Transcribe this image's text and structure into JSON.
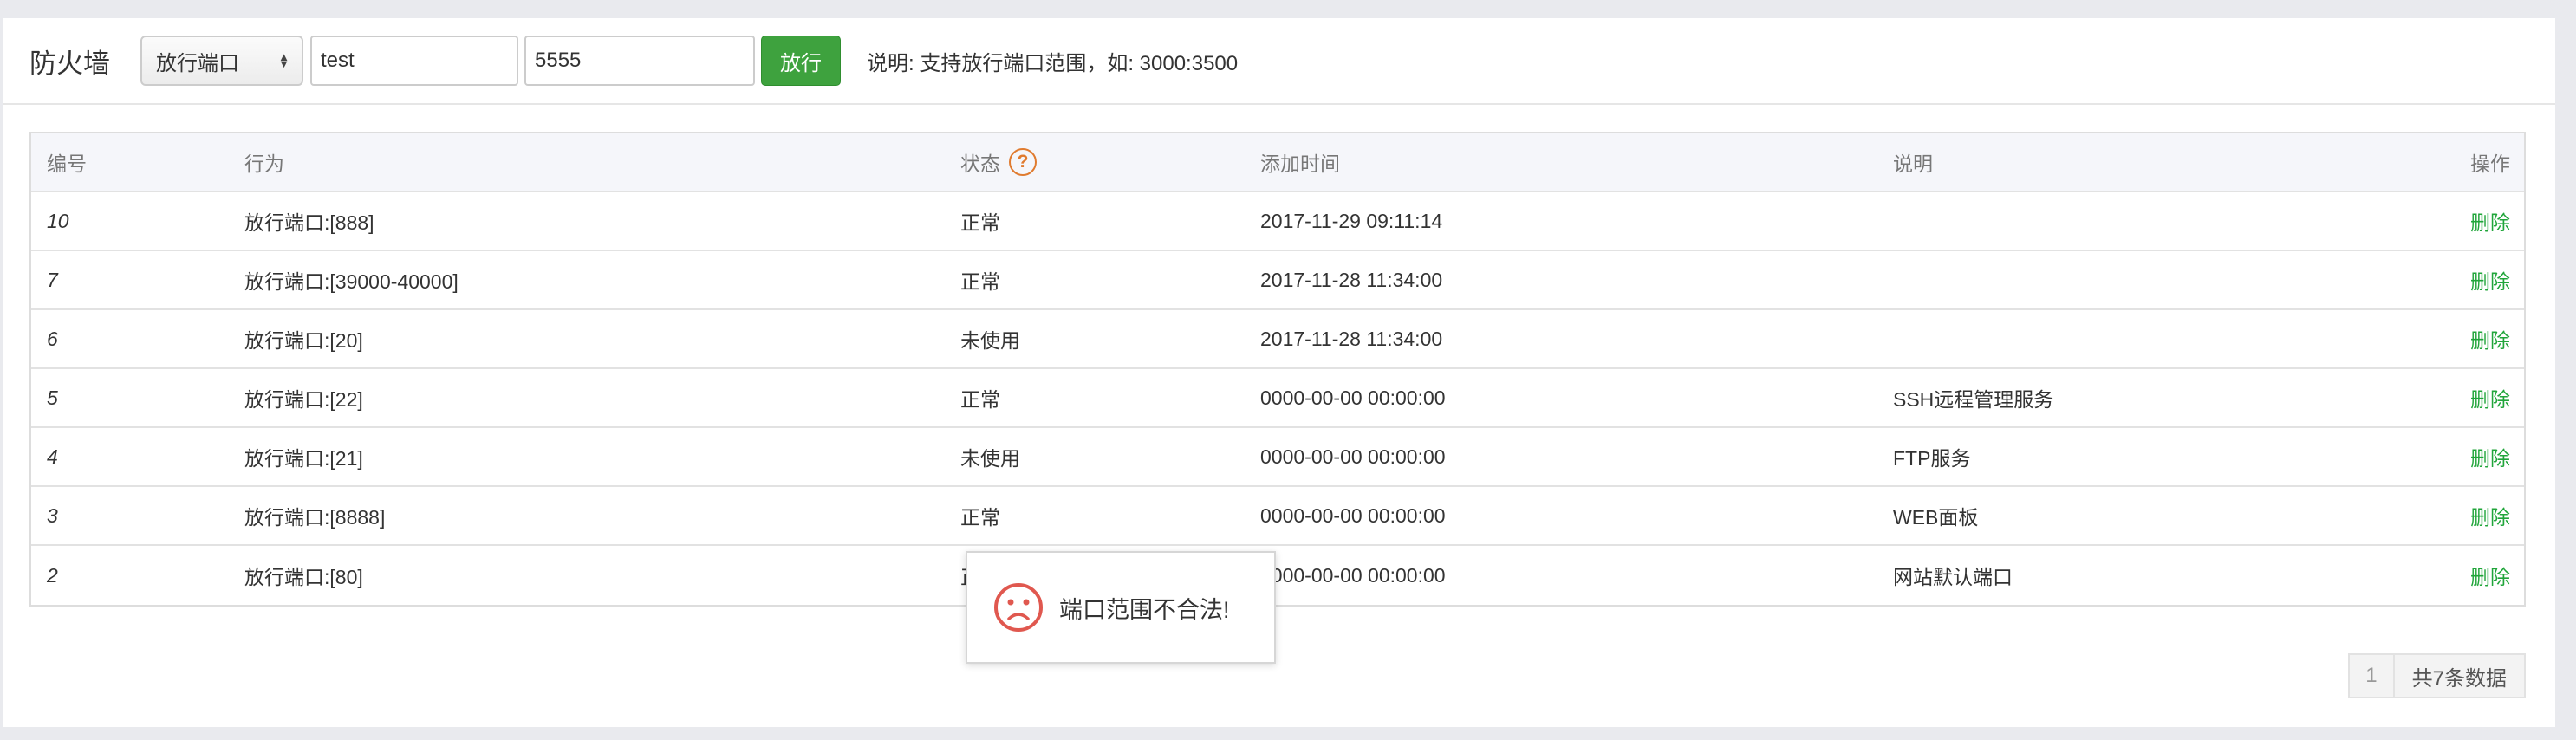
{
  "toolbar": {
    "title": "防火墙",
    "select_value": "放行端口",
    "input1_value": "test",
    "input2_value": "5555",
    "allow_button": "放行",
    "hint": "说明: 支持放行端口范围，如: 3000:3500"
  },
  "table": {
    "headers": [
      "编号",
      "行为",
      "状态",
      "添加时间",
      "说明",
      "操作"
    ],
    "rows": [
      {
        "id": "10",
        "action": "放行端口:[888]",
        "status": "正常",
        "time": "2017-11-29 09:11:14",
        "note": "",
        "op": "删除"
      },
      {
        "id": "7",
        "action": "放行端口:[39000-40000]",
        "status": "正常",
        "time": "2017-11-28 11:34:00",
        "note": "",
        "op": "删除"
      },
      {
        "id": "6",
        "action": "放行端口:[20]",
        "status": "未使用",
        "time": "2017-11-28 11:34:00",
        "note": "",
        "op": "删除"
      },
      {
        "id": "5",
        "action": "放行端口:[22]",
        "status": "正常",
        "time": "0000-00-00 00:00:00",
        "note": "SSH远程管理服务",
        "op": "删除"
      },
      {
        "id": "4",
        "action": "放行端口:[21]",
        "status": "未使用",
        "time": "0000-00-00 00:00:00",
        "note": "FTP服务",
        "op": "删除"
      },
      {
        "id": "3",
        "action": "放行端口:[8888]",
        "status": "正常",
        "time": "0000-00-00 00:00:00",
        "note": "WEB面板",
        "op": "删除"
      },
      {
        "id": "2",
        "action": "放行端口:[80]",
        "status": "正常",
        "time": "0000-00-00 00:00:00",
        "note": "网站默认端口",
        "op": "删除"
      }
    ]
  },
  "pager": {
    "page": "1",
    "total": "共7条数据"
  },
  "toast": {
    "message": "端口范围不合法!",
    "icon": "sad-face-icon"
  },
  "colors": {
    "accent_green": "#20a53a",
    "warning_orange": "#e07b2f",
    "error_red": "#e0584f"
  }
}
